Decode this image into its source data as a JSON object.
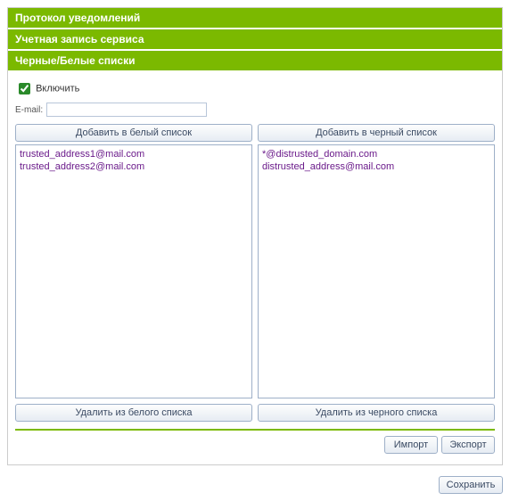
{
  "sections": {
    "protocol": "Протокол уведомлений",
    "account": "Учетная запись сервиса",
    "lists": "Черные/Белые списки"
  },
  "enable_label": "Включить",
  "enable_checked": true,
  "email_label": "E-mail:",
  "email_value": "",
  "whitelist": {
    "add_label": "Добавить в белый список",
    "items": [
      "trusted_address1@mail.com",
      "trusted_address2@mail.com"
    ],
    "remove_label": "Удалить из белого списка"
  },
  "blacklist": {
    "add_label": "Добавить в черный список",
    "items": [
      "*@distrusted_domain.com",
      "distrusted_address@mail.com"
    ],
    "remove_label": "Удалить из черного списка"
  },
  "import_label": "Импорт",
  "export_label": "Экспорт",
  "save_label": "Сохранить"
}
